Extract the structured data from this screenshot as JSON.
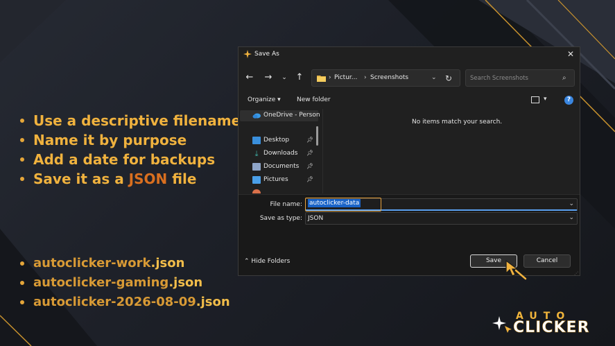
{
  "tips": [
    {
      "text": "Use a descriptive filename",
      "accent": "",
      "after": ""
    },
    {
      "text": "Name it by purpose",
      "accent": "",
      "after": ""
    },
    {
      "text": "Add a date for backups",
      "accent": "",
      "after": ""
    },
    {
      "text": "Save it as a ",
      "accent": "JSON",
      "after": " file"
    }
  ],
  "examples": [
    {
      "base": "autoclicker-work",
      "ext": ".json"
    },
    {
      "base": "autoclicker-gaming",
      "ext": ".json"
    },
    {
      "base": "autoclicker-2026-08-09",
      "ext": ".json"
    }
  ],
  "dialog": {
    "title": "Save As",
    "address": {
      "crumb1": "Pictur...",
      "crumb2": "Screenshots"
    },
    "search_placeholder": "Search Screenshots",
    "organize_label": "Organize ▾",
    "new_folder_label": "New folder",
    "nav_items": [
      {
        "label": "OneDrive - Person",
        "icon": "onedrive-icon",
        "pinned": false
      },
      {
        "label": "Desktop",
        "icon": "desktop-icon",
        "pinned": true
      },
      {
        "label": "Downloads",
        "icon": "downloads-icon",
        "pinned": true
      },
      {
        "label": "Documents",
        "icon": "documents-icon",
        "pinned": true
      },
      {
        "label": "Pictures",
        "icon": "pictures-icon",
        "pinned": true
      }
    ],
    "empty_message": "No items match your search.",
    "file_name_label": "File name:",
    "file_name_value": "autoclicker-data",
    "save_as_type_label": "Save as type:",
    "save_as_type_value": "JSON",
    "hide_folders_label": "Hide Folders",
    "save_label": "Save",
    "cancel_label": "Cancel"
  },
  "brand": {
    "line1": "AUTO",
    "line2": "CLICKER"
  },
  "colors": {
    "accent": "#f0b23e",
    "json_accent": "#d96f1f",
    "dialog_bg": "#202020",
    "selection": "#1a64c8"
  }
}
